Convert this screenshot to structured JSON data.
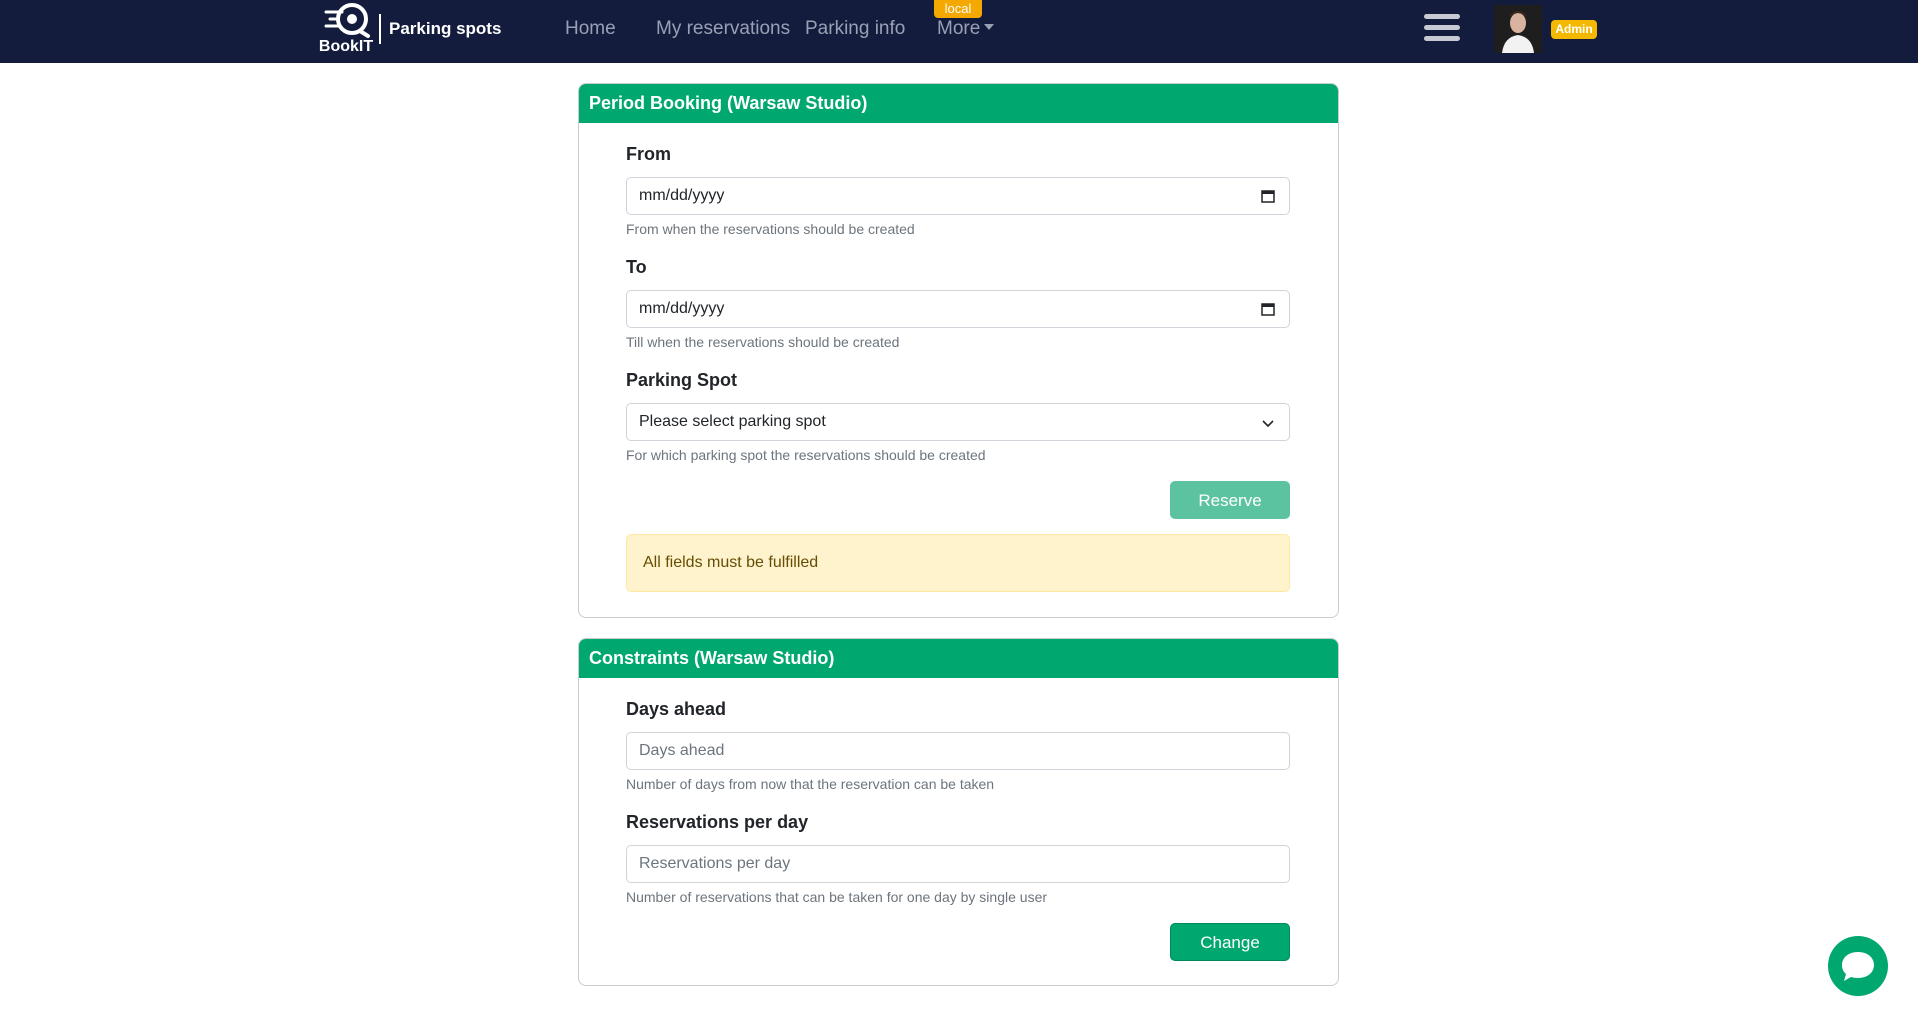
{
  "navbar": {
    "brand_name": "BookIT",
    "section_title": "Parking spots",
    "links": [
      {
        "label": "Home"
      },
      {
        "label": "My reservations"
      },
      {
        "label": "Parking info"
      },
      {
        "label": "More"
      }
    ],
    "env_badge": "local",
    "user_badge": "Admin",
    "bg_color": "#131c3d"
  },
  "period_booking": {
    "title": "Period Booking (Warsaw Studio)",
    "from": {
      "label": "From",
      "value": "mm/dd/yyyy",
      "help": "From when the reservations should be created"
    },
    "to": {
      "label": "To",
      "value": "mm/dd/yyyy",
      "help": "Till when the reservations should be created"
    },
    "parking_spot": {
      "label": "Parking Spot",
      "selected": "Please select parking spot",
      "help": "For which parking spot the reservations should be created"
    },
    "reserve_label": "Reserve",
    "alert": "All fields must be fulfilled"
  },
  "constraints": {
    "title": "Constraints (Warsaw Studio)",
    "days_ahead": {
      "label": "Days ahead",
      "placeholder": "Days ahead",
      "help": "Number of days from now that the reservation can be taken"
    },
    "reservations_per_day": {
      "label": "Reservations per day",
      "placeholder": "Reservations per day",
      "help": "Number of reservations that can be taken for one day by single user"
    },
    "change_label": "Change"
  },
  "colors": {
    "accent": "#00a870",
    "warning_bg": "#fff3cd"
  }
}
